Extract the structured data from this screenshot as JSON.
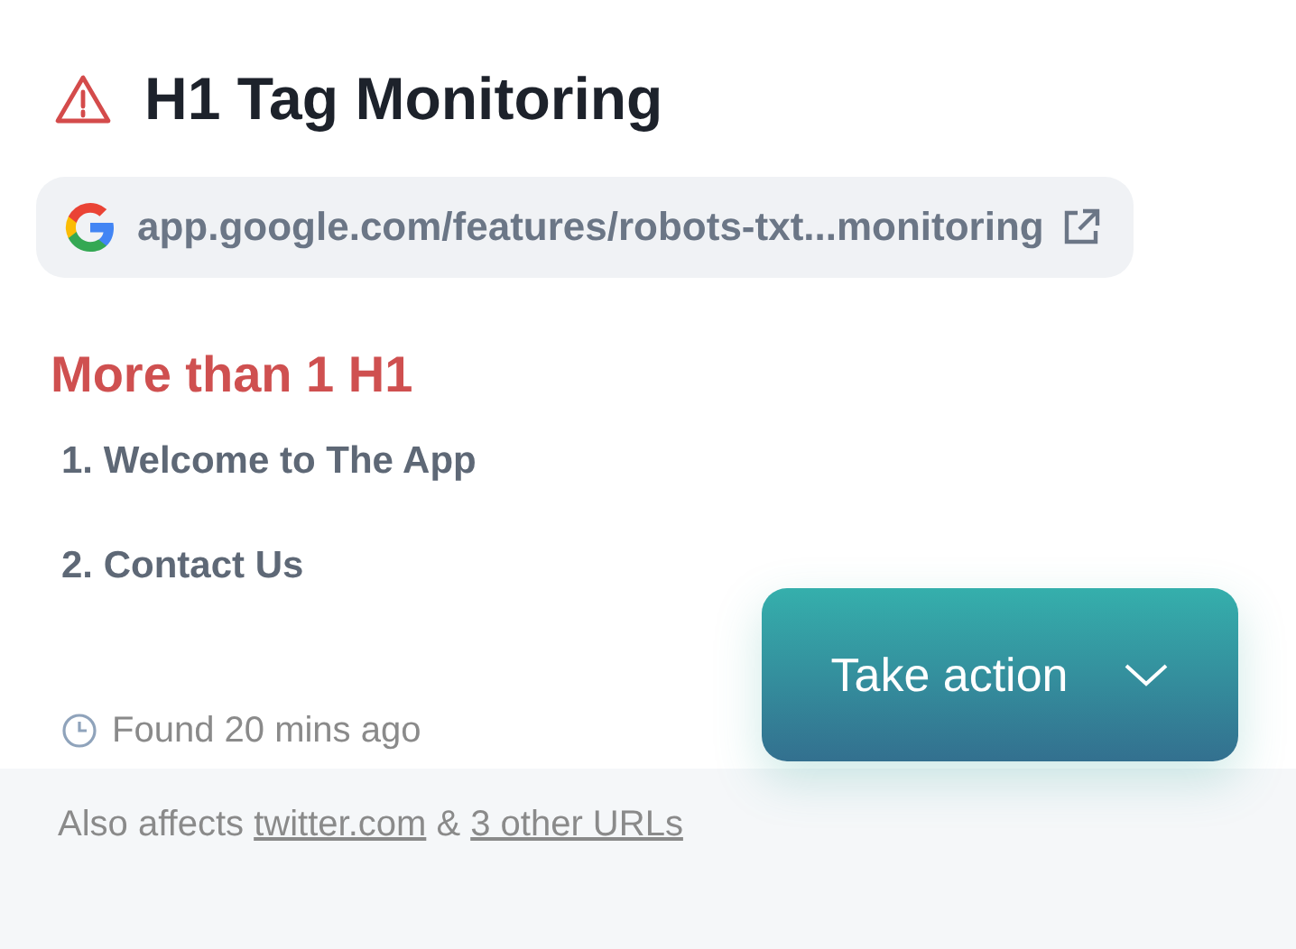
{
  "title": "H1 Tag Monitoring",
  "url": {
    "text": "app.google.com/features/robots-txt...monitoring"
  },
  "issue": {
    "heading": "More than 1 H1",
    "items": [
      "1. Welcome to The App",
      "2. Contact Us"
    ]
  },
  "found": "Found 20 mins ago",
  "action_button": {
    "label": "Take action"
  },
  "footer": {
    "prefix": "Also affects",
    "links": [
      "twitter.com",
      "3 other URLs"
    ],
    "joiner": "&"
  }
}
